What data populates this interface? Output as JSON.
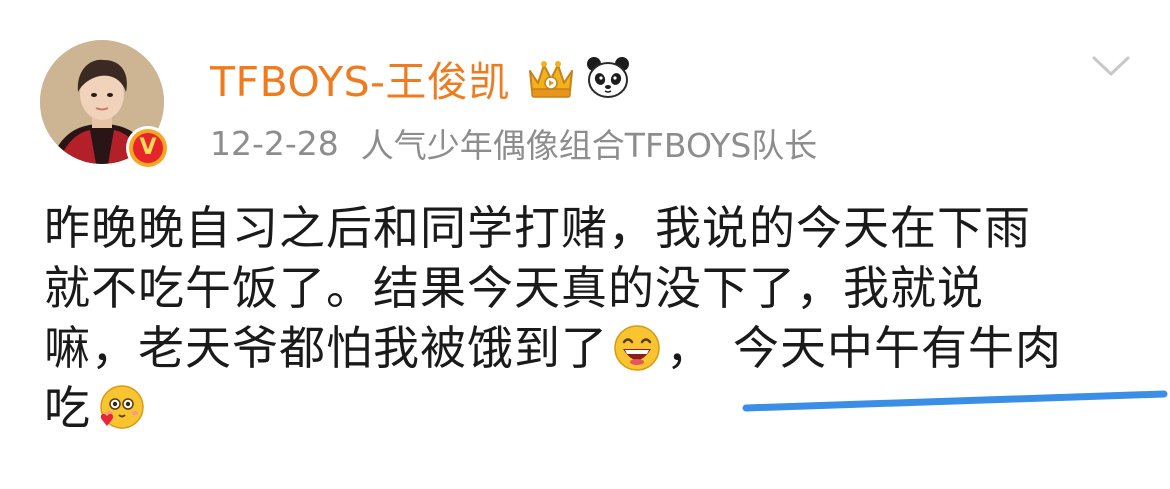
{
  "post": {
    "username": "TFBOYS-王俊凯",
    "date": "12-2-28",
    "description": "人气少年偶像组合TFBOYS队长",
    "verified_badge": "V",
    "icons": {
      "crown": "crown-badge-icon",
      "panda": "panda-icon",
      "more": "chevron-down-icon",
      "laugh": "laughing-emoji-icon",
      "cute": "cute-love-emoji-icon"
    },
    "body_lines": [
      "昨晚晚自习之后和同学打赌，我说的今天在下雨",
      "就不吃午饭了。结果今天真的没下了，我就说",
      "嘛，老天爷都怕我被饿到了",
      "，",
      "今天中午有牛肉",
      "吃"
    ],
    "colors": {
      "username": "#f07b1f",
      "meta": "#8d8d8d",
      "text": "#1a1a1a",
      "underline": "#3a8ee6"
    }
  }
}
